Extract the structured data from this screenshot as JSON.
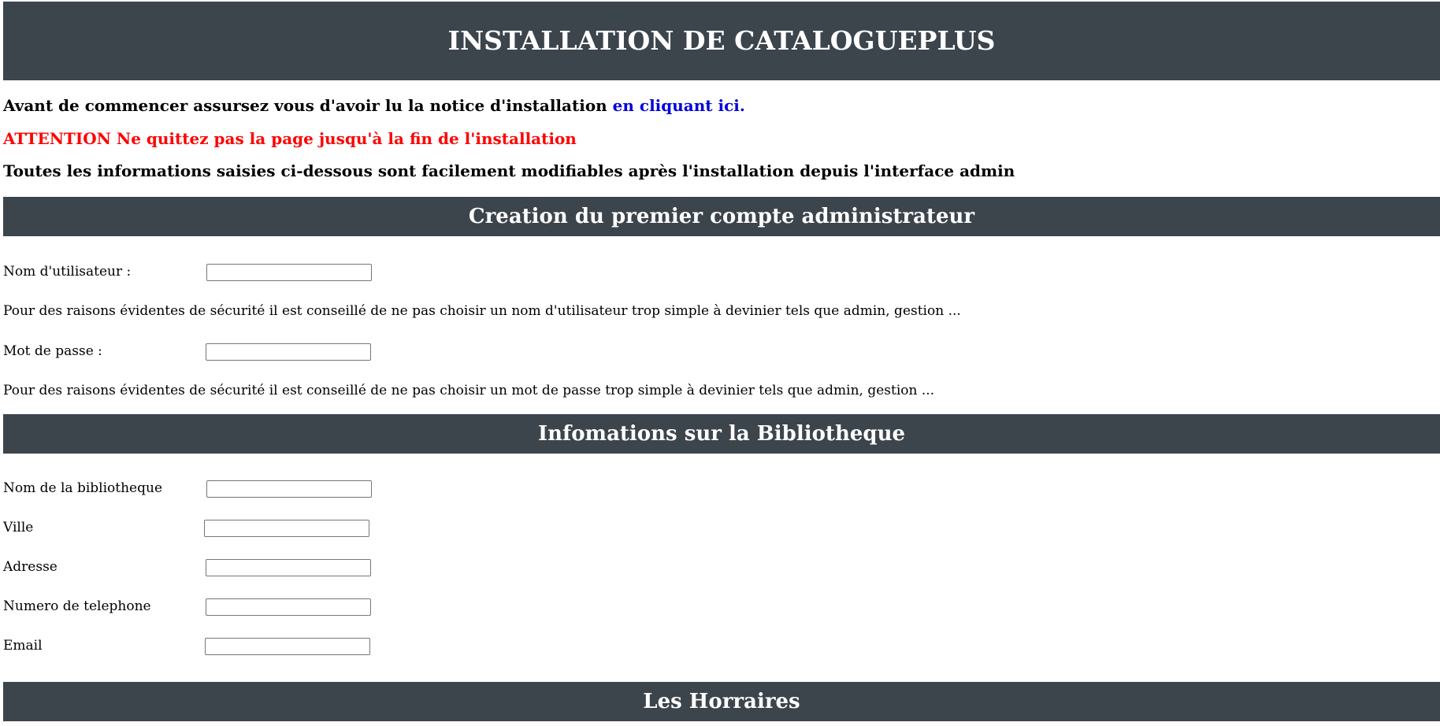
{
  "header": {
    "title": "INSTALLATION DE CATALOGUEPLUS"
  },
  "intro": {
    "notice_text": "Avant de commencer assursez vous d'avoir lu la notice d'installation ",
    "notice_link": "en cliquant ici.",
    "warning": "ATTENTION Ne quittez pas la page jusqu'à la fin de l'installation",
    "info": "Toutes les informations saisies ci-dessous sont facilement modifiables après l'installation depuis l'interface admin"
  },
  "admin_section": {
    "title": "Creation du premier compte administrateur",
    "username_label": "Nom d'utilisateur :",
    "username_value": "",
    "username_hint": "Pour des raisons évidentes de sécurité il est conseillé de ne pas choisir un nom d'utilisateur trop simple à devinier tels que admin, gestion ...",
    "password_label": "Mot de passe :",
    "password_value": "",
    "password_hint": "Pour des raisons évidentes de sécurité il est conseillé de ne pas choisir un mot de passe trop simple à devinier tels que admin, gestion ..."
  },
  "library_section": {
    "title": "Infomations sur la Bibliotheque",
    "name_label": "Nom de la bibliotheque",
    "city_label": "Ville",
    "address_label": "Adresse",
    "phone_label": "Numero de telephone",
    "email_label": "Email",
    "name_value": "",
    "city_value": "",
    "address_value": "",
    "phone_value": "",
    "email_value": ""
  },
  "hours_section": {
    "title": "Les Horraires"
  }
}
